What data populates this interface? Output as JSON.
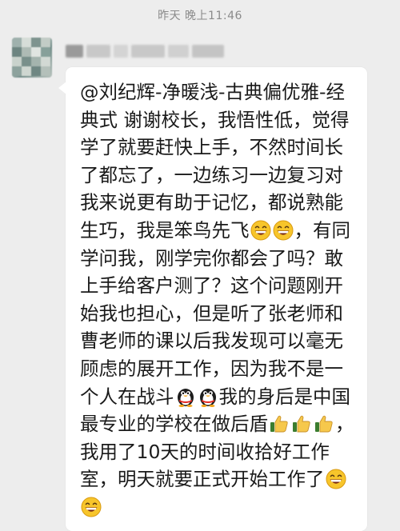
{
  "chat": {
    "timestamp": "昨天 晚上11:46",
    "sender_name": "张",
    "message": {
      "segments": [
        {
          "type": "text",
          "value": "@刘纪辉-净暖浅-古典偏优雅-经典式  谢谢校长，我悟性低，觉得学了就要赶快上手，不然时间长了都忘了，一边练习一边复习对我来说更有助于记忆，都说熟能生巧，我是笨鸟先飞"
        },
        {
          "type": "emoji",
          "name": "grin-emoji"
        },
        {
          "type": "emoji",
          "name": "grin-emoji"
        },
        {
          "type": "text",
          "value": "，有同学问我，刚学完你都会了吗？敢上手给客户测了？这个问题刚开始我也担心，但是听了张老师和曹老师的课以后我发现可以毫无顾虑的展开工作，因为我不是一个人在战斗"
        },
        {
          "type": "emoji",
          "name": "penguin-emoji"
        },
        {
          "type": "emoji",
          "name": "penguin-emoji"
        },
        {
          "type": "text",
          "value": "我的身后是中国最专业的学校在做后盾"
        },
        {
          "type": "emoji",
          "name": "thumbs-up-emoji"
        },
        {
          "type": "emoji",
          "name": "thumbs-up-emoji"
        },
        {
          "type": "emoji",
          "name": "thumbs-up-emoji"
        },
        {
          "type": "text",
          "value": "，我用了10天的时间收拾好工作室，明天就要正式开始工作了"
        },
        {
          "type": "emoji",
          "name": "grin-emoji"
        },
        {
          "type": "emoji",
          "name": "grin-emoji"
        }
      ]
    }
  },
  "colors": {
    "background": "#ededed",
    "bubble": "#ffffff",
    "text": "#1a1a1a",
    "timestamp": "#8a8a8a"
  }
}
